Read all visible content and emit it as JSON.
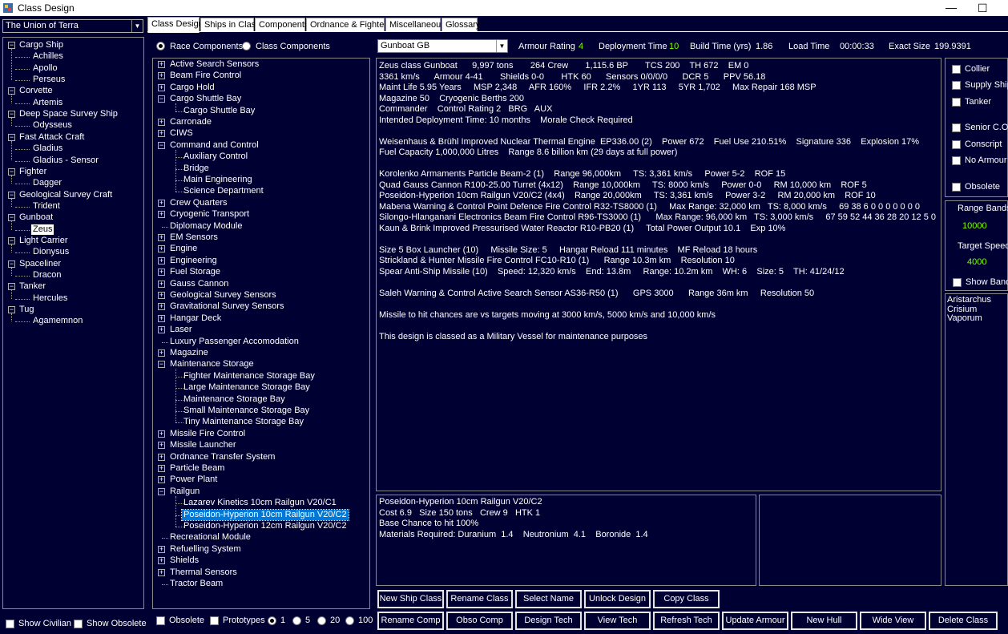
{
  "window": {
    "title": "Class Design"
  },
  "left": {
    "race": "The Union of Terra",
    "classes": [
      {
        "label": "Cargo Ship",
        "children": [
          "Achilles",
          "Apollo",
          "Perseus"
        ]
      },
      {
        "label": "Corvette",
        "children": [
          "Artemis"
        ]
      },
      {
        "label": "Deep Space Survey Ship",
        "children": [
          "Odysseus"
        ]
      },
      {
        "label": "Fast Attack Craft",
        "children": [
          "Gladius",
          "Gladius - Sensor"
        ]
      },
      {
        "label": "Fighter",
        "children": [
          "Dagger"
        ]
      },
      {
        "label": "Geological Survey Craft",
        "children": [
          "Trident"
        ]
      },
      {
        "label": "Gunboat",
        "children": [
          "Zeus"
        ]
      },
      {
        "label": "Light Carrier",
        "children": [
          "Dionysus"
        ]
      },
      {
        "label": "Spaceliner",
        "children": [
          "Dracon"
        ]
      },
      {
        "label": "Tanker",
        "children": [
          "Hercules"
        ]
      },
      {
        "label": "Tug",
        "children": [
          "Agamemnon"
        ]
      }
    ],
    "selected_class": "Zeus",
    "show_civilian": "Show Civilian",
    "show_obsolete": "Show Obsolete"
  },
  "tabs": [
    "Class Design",
    "Ships in Class",
    "Components",
    "Ordnance & Fighters",
    "Miscellaneous",
    "Glossary"
  ],
  "filters": {
    "race_components": "Race Components",
    "class_components": "Class Components",
    "obsolete": "Obsolete",
    "prototypes": "Prototypes",
    "count_options": [
      "1",
      "5",
      "20",
      "100"
    ],
    "count_selected": "1"
  },
  "components": [
    {
      "label": "Active Search Sensors",
      "expanded": false
    },
    {
      "label": "Beam Fire Control",
      "expanded": false
    },
    {
      "label": "Cargo Hold",
      "expanded": false
    },
    {
      "label": "Cargo Shuttle Bay",
      "expanded": true,
      "children": [
        "Cargo Shuttle Bay"
      ]
    },
    {
      "label": "Carronade",
      "expanded": false
    },
    {
      "label": "CIWS",
      "expanded": false
    },
    {
      "label": "Command and Control",
      "expanded": true,
      "children": [
        "Auxiliary Control",
        "Bridge",
        "Main Engineering",
        "Science Department"
      ]
    },
    {
      "label": "Crew Quarters",
      "expanded": false
    },
    {
      "label": "Cryogenic Transport",
      "expanded": false
    },
    {
      "label": "Diplomacy Module",
      "leaf": true
    },
    {
      "label": "EM Sensors",
      "expanded": false
    },
    {
      "label": "Engine",
      "expanded": false
    },
    {
      "label": "Engineering",
      "expanded": false
    },
    {
      "label": "Fuel Storage",
      "expanded": false
    },
    {
      "label": "Gauss Cannon",
      "expanded": false
    },
    {
      "label": "Geological Survey Sensors",
      "expanded": false
    },
    {
      "label": "Gravitational Survey Sensors",
      "expanded": false
    },
    {
      "label": "Hangar Deck",
      "expanded": false
    },
    {
      "label": "Laser",
      "expanded": false
    },
    {
      "label": "Luxury Passenger Accomodation",
      "leaf": true
    },
    {
      "label": "Magazine",
      "expanded": false
    },
    {
      "label": "Maintenance Storage",
      "expanded": true,
      "children": [
        "Fighter Maintenance Storage Bay",
        "Large Maintenance Storage Bay",
        "Maintenance Storage Bay",
        "Small Maintenance Storage Bay",
        "Tiny Maintenance Storage Bay"
      ]
    },
    {
      "label": "Missile Fire Control",
      "expanded": false
    },
    {
      "label": "Missile Launcher",
      "expanded": false
    },
    {
      "label": "Ordnance Transfer System",
      "expanded": false
    },
    {
      "label": "Particle Beam",
      "expanded": false
    },
    {
      "label": "Power Plant",
      "expanded": false
    },
    {
      "label": "Railgun",
      "expanded": true,
      "children": [
        "Lazarev Kinetics 10cm Railgun V20/C1",
        "Poseidon-Hyperion 10cm Railgun V20/C2",
        "Poseidon-Hyperion 12cm Railgun V20/C2"
      ]
    },
    {
      "label": "Recreational Module",
      "leaf": true
    },
    {
      "label": "Refuelling System",
      "expanded": false
    },
    {
      "label": "Shields",
      "expanded": false
    },
    {
      "label": "Thermal Sensors",
      "expanded": false
    },
    {
      "label": "Tractor Beam",
      "leaf": true
    }
  ],
  "selected_component": "Poseidon-Hyperion 10cm Railgun V20/C2",
  "header": {
    "hull": "Gunboat  GB",
    "armour_label": "Armour Rating",
    "armour_value": "4",
    "deploy_label": "Deployment Time",
    "deploy_value": "10",
    "build_label": "Build Time (yrs)",
    "build_value": "1.86",
    "load_label": "Load Time",
    "load_value": "00:00:33",
    "size_label": "Exact Size",
    "size_value": "199.9391"
  },
  "summary": [
    "Zeus class Gunboat      9,997 tons       264 Crew       1,115.6 BP       TCS 200    TH 672    EM 0",
    "3361 km/s      Armour 4-41       Shields 0-0       HTK 60      Sensors 0/0/0/0      DCR 5      PPV 56.18",
    "Maint Life 5.95 Years     MSP 2,348     AFR 160%     IFR 2.2%     1YR 113     5YR 1,702     Max Repair 168 MSP",
    "Magazine 50    Cryogenic Berths 200",
    "Commander    Control Rating 2   BRG   AUX",
    "Intended Deployment Time: 10 months    Morale Check Required",
    "",
    "Weisenhaus & Brühl Improved Nuclear Thermal Engine  EP336.00 (2)    Power 672    Fuel Use 210.51%    Signature 336    Explosion 17%",
    "Fuel Capacity 1,000,000 Litres    Range 8.6 billion km (29 days at full power)",
    "",
    "Korolenko Armaments Particle Beam-2 (1)    Range 96,000km     TS: 3,361 km/s     Power 5-2    ROF 15",
    "Quad Gauss Cannon R100-25.00 Turret (4x12)    Range 10,000km     TS: 8000 km/s     Power 0-0     RM 10,000 km    ROF 5",
    "Poseidon-Hyperion 10cm Railgun V20/C2 (4x4)    Range 20,000km     TS: 3,361 km/s     Power 3-2     RM 20,000 km    ROF 10",
    "Mabena Warning & Control Point Defence Fire Control R32-TS8000 (1)     Max Range: 32,000 km   TS: 8,000 km/s     69 38 6 0 0 0 0 0 0 0",
    "Silongo-Hlanganani Electronics Beam Fire Control R96-TS3000 (1)      Max Range: 96,000 km   TS: 3,000 km/s     67 59 52 44 36 28 20 12 5 0",
    "Kaun & Brink Improved Pressurised Water Reactor R10-PB20 (1)     Total Power Output 10.1    Exp 10%",
    "",
    "Size 5 Box Launcher (10)     Missile Size: 5     Hangar Reload 111 minutes    MF Reload 18 hours",
    "Strickland & Hunter Missile Fire Control FC10-R10 (1)      Range 10.3m km    Resolution 10",
    "Spear Anti-Ship Missile (10)    Speed: 12,320 km/s    End: 13.8m     Range: 10.2m km    WH: 6    Size: 5    TH: 41/24/12",
    "",
    "Saleh Warning & Control Active Search Sensor AS36-R50 (1)      GPS 3000      Range 36m km     Resolution 50",
    "",
    "Missile to hit chances are vs targets moving at 3000 km/s, 5000 km/s and 10,000 km/s",
    "",
    "This design is classed as a Military Vessel for maintenance purposes"
  ],
  "detail": [
    "Poseidon-Hyperion 10cm Railgun V20/C2",
    "Cost 6.9   Size 150 tons   Crew 9   HTK 1",
    "Base Chance to hit 100%",
    "Materials Required: Duranium  1.4    Neutronium  4.1    Boronide  1.4"
  ],
  "options": [
    "Collier",
    "Supply Ship",
    "Tanker",
    "Senior C.O.",
    "Conscript",
    "No Armour",
    "Obsolete"
  ],
  "range": {
    "bands_label": "Range Bands",
    "bands_value": "10000",
    "speed_label": "Target Speed",
    "speed_value": "4000",
    "show_bands": "Show Bands"
  },
  "names": [
    "Aristarchus",
    "Crisium",
    "Vaporum"
  ],
  "buttons_row1": [
    "New Ship Class",
    "Rename Class",
    "Select Name",
    "Unlock Design",
    "Copy Class"
  ],
  "buttons_row2": [
    "Rename Comp",
    "Obso Comp",
    "Design Tech",
    "View Tech",
    "Refresh Tech",
    "Update Armour",
    "New Hull",
    "Wide View",
    "Delete Class"
  ]
}
